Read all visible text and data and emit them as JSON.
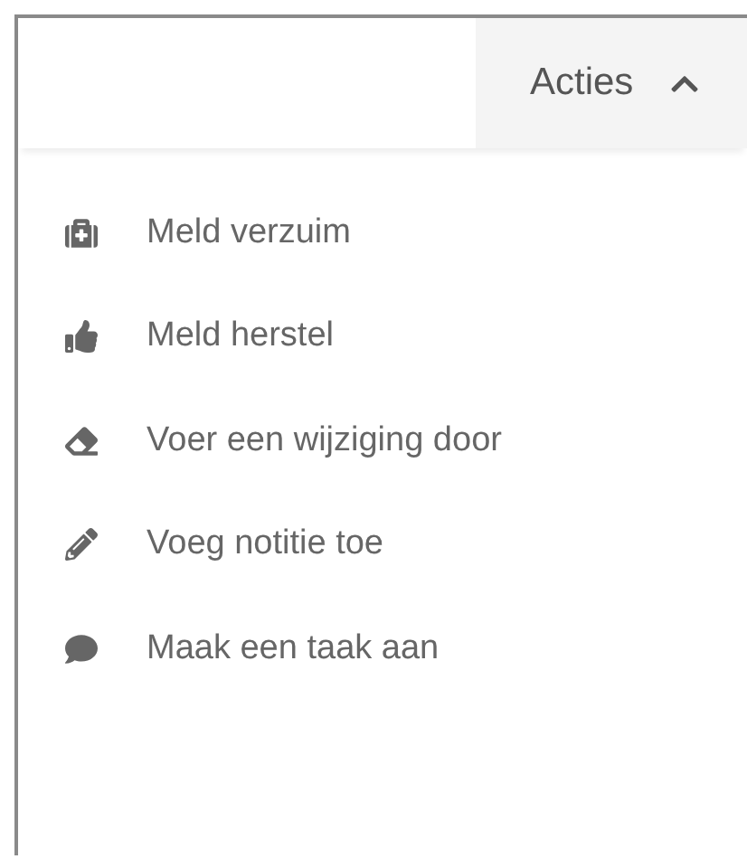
{
  "menu_button": {
    "label": "Acties",
    "expanded": true
  },
  "items": [
    {
      "label": "Meld verzuim"
    },
    {
      "label": "Meld herstel"
    },
    {
      "label": "Voer een wijziging door"
    },
    {
      "label": "Voeg notitie toe"
    },
    {
      "label": "Maak een taak aan"
    }
  ]
}
